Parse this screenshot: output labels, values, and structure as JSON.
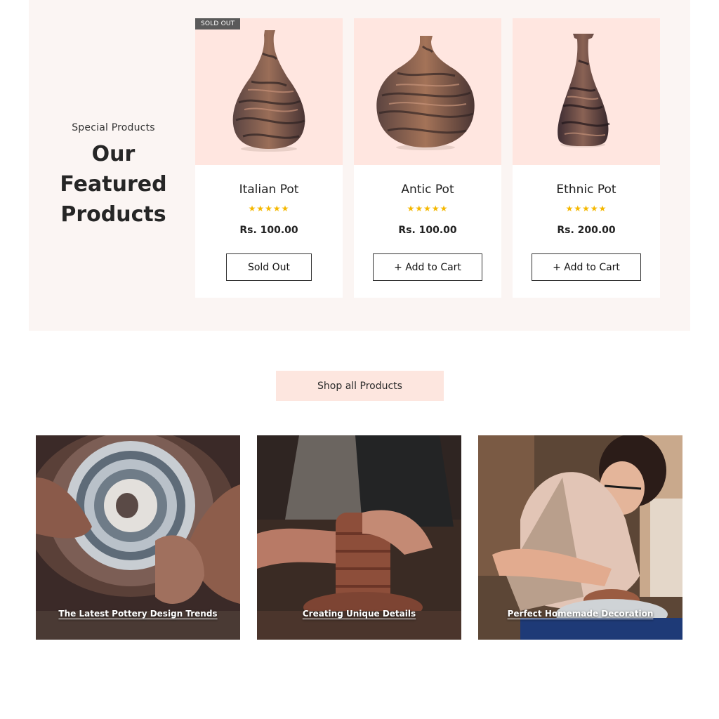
{
  "featured": {
    "subtitle": "Special Products",
    "title_line1": "Our",
    "title_line2": "Featured",
    "title_line3": "Products",
    "products": [
      {
        "badge": "SOLD OUT",
        "name": "Italian Pot",
        "stars": "★★★★★",
        "rating": 5,
        "price": "Rs. 100.00",
        "button": "Sold Out"
      },
      {
        "name": "Antic Pot",
        "stars": "★★★★★",
        "rating": 5,
        "price": "Rs. 100.00",
        "button": "+ Add to Cart"
      },
      {
        "name": "Ethnic Pot",
        "stars": "★★★★★",
        "rating": 5,
        "price": "Rs. 200.00",
        "button": "+ Add to Cart"
      }
    ]
  },
  "shop_all": {
    "label": "Shop all Products"
  },
  "blog": {
    "posts": [
      {
        "title": "The Latest Pottery Design Trends"
      },
      {
        "title": "Creating Unique Details"
      },
      {
        "title": "Perfect Homemade Decoration"
      }
    ]
  },
  "colors": {
    "section_bg": "#fbf5f3",
    "image_bg": "#ffe6e0",
    "shop_button_bg": "#fde6df",
    "star": "#f5b800",
    "badge_bg": "#5a5a5a"
  }
}
